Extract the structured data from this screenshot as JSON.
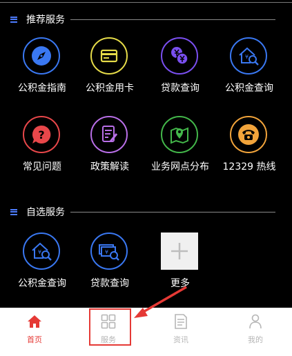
{
  "recommended": {
    "title": "推荐服务",
    "items": [
      {
        "label": "公积金指南",
        "icon": "compass-icon",
        "color": "#3a78f2"
      },
      {
        "label": "公积金用卡",
        "icon": "card-icon",
        "color": "#e6dc49"
      },
      {
        "label": "贷款查询",
        "icon": "yen-coins-icon",
        "color": "#7a4ff0"
      },
      {
        "label": "公积金查询",
        "icon": "house-search-icon",
        "color": "#3a78f2"
      },
      {
        "label": "常见问题",
        "icon": "question-bubble-icon",
        "color": "#e8474a"
      },
      {
        "label": "政策解读",
        "icon": "document-edit-icon",
        "color": "#b96fe8"
      },
      {
        "label": "业务网点分布",
        "icon": "map-pin-icon",
        "color": "#43b74a"
      },
      {
        "label": "12329 热线",
        "icon": "telephone-icon",
        "color": "#f2a43b"
      }
    ]
  },
  "custom": {
    "title": "自选服务",
    "items": [
      {
        "label": "公积金查询",
        "icon": "house-search-icon",
        "color": "#3a78f2"
      },
      {
        "label": "贷款查询",
        "icon": "money-search-icon",
        "color": "#3a78f2"
      },
      {
        "label": "更多",
        "icon": "plus-icon",
        "color": "#bdbdbd"
      }
    ]
  },
  "tabbar": {
    "active_color": "#e53935",
    "inactive_color": "#b5b5b5",
    "items": [
      {
        "label": "首页",
        "icon": "home-icon",
        "active": true
      },
      {
        "label": "服务",
        "icon": "grid-icon",
        "active": false
      },
      {
        "label": "资讯",
        "icon": "news-icon",
        "active": false
      },
      {
        "label": "我的",
        "icon": "person-icon",
        "active": false
      }
    ]
  },
  "annotation": {
    "color": "#e53935"
  }
}
